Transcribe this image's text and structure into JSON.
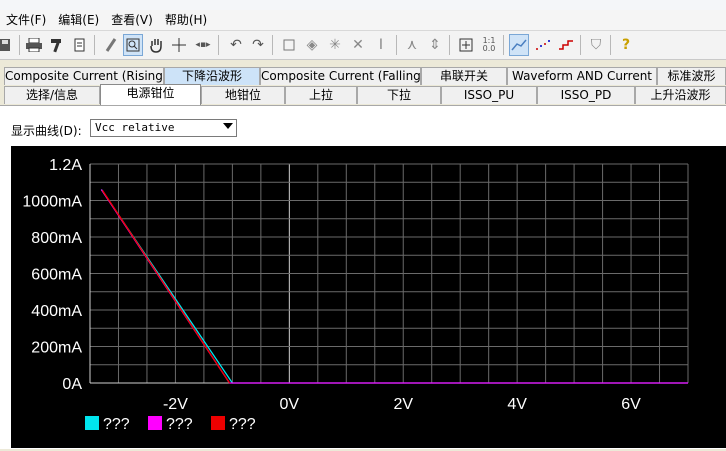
{
  "window": {
    "title_fragment": "..."
  },
  "menu": [
    {
      "label": "文件(F)"
    },
    {
      "label": "编辑(E)"
    },
    {
      "label": "查看(V)"
    },
    {
      "label": "帮助(H)"
    }
  ],
  "toolbar": {
    "icons": [
      "save-icon",
      "print-icon",
      "hammer-icon",
      "document-icon",
      "pencil-icon",
      "zoom-icon",
      "pan-hand-icon",
      "move-cross-icon",
      "stretch-icon",
      "undo-icon",
      "redo-icon",
      "box-icon",
      "diamond-icon",
      "star-icon",
      "x-cross-icon",
      "text-cursor-icon",
      "fork-icon",
      "up-down-icon",
      "fit-icon",
      "scale-icon",
      "line-plot-icon",
      "dot-plot-icon",
      "step-plot-icon",
      "shield-icon",
      "help-icon"
    ],
    "active": [
      "zoom-icon",
      "line-plot-icon"
    ]
  },
  "tabs": {
    "row1": [
      "Composite Current (Rising)",
      "下降沿波形",
      "Composite Current (Falling)",
      "串联开关",
      "Waveform AND Current",
      "标准波形"
    ],
    "row1_selected": "下降沿波形",
    "row2": [
      "选择/信息",
      "电源钳位",
      "地钳位",
      "上拉",
      "下拉",
      "ISSO_PU",
      "ISSO_PD",
      "上升沿波形"
    ],
    "row2_active": "电源钳位"
  },
  "curve_selector": {
    "label": "显示曲线(D):",
    "value": "Vcc relative"
  },
  "chart_data": {
    "type": "line",
    "title": "",
    "xlabel": "",
    "ylabel": "",
    "xlim": [
      -3.5,
      7.0
    ],
    "ylim": [
      0,
      1.2
    ],
    "x_ticks": [
      -2,
      0,
      2,
      4,
      6
    ],
    "x_tick_labels": [
      "-2V",
      "0V",
      "2V",
      "4V",
      "6V"
    ],
    "y_ticks": [
      0,
      0.2,
      0.4,
      0.6,
      0.8,
      1.0,
      1.2
    ],
    "y_tick_labels": [
      "0A",
      "200mA",
      "400mA",
      "600mA",
      "800mA",
      "1000mA",
      "1.2A"
    ],
    "grid": true,
    "background": "#000000",
    "legend_position": "bottom-left",
    "series": [
      {
        "name": "???",
        "color": "#00e5ee",
        "x": [
          -3.3,
          -1.0,
          7.0
        ],
        "y": [
          1.06,
          0.0,
          0.0
        ]
      },
      {
        "name": "???",
        "color": "#ff00ff",
        "x": [
          -3.3,
          -1.05,
          7.0
        ],
        "y": [
          1.06,
          0.0,
          0.0
        ]
      },
      {
        "name": "???",
        "color": "#ee0000",
        "x": [
          -3.28,
          -1.05
        ],
        "y": [
          1.055,
          0.0
        ]
      }
    ]
  }
}
